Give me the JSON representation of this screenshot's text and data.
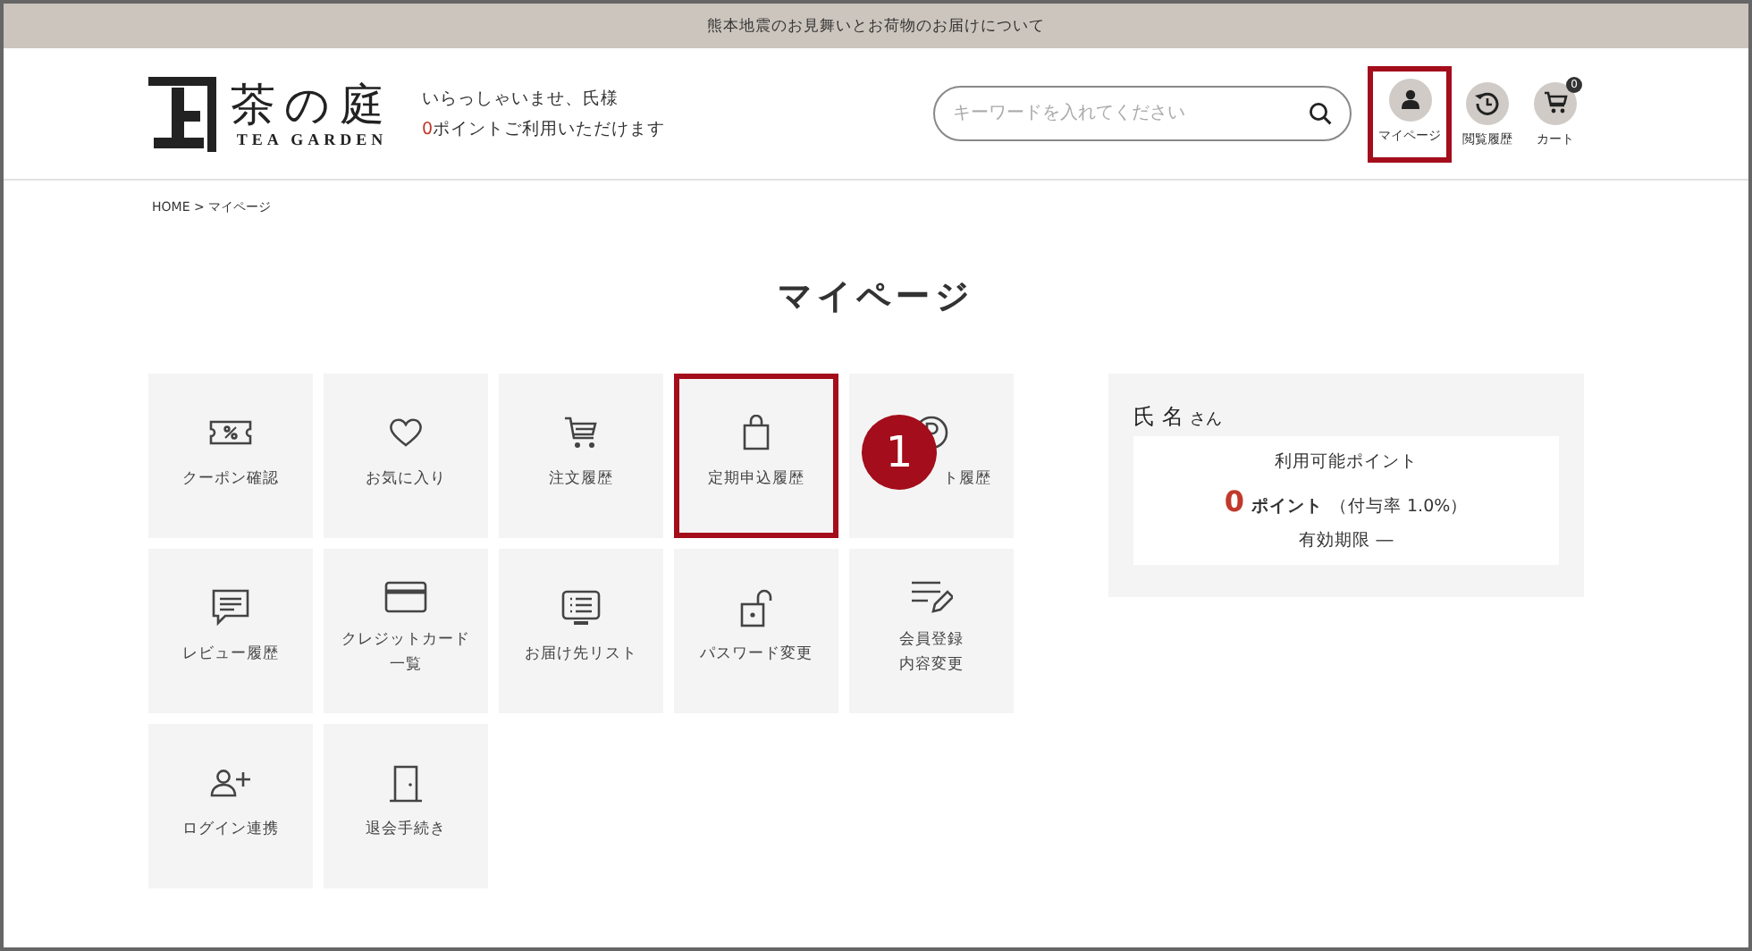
{
  "notice": "熊本地震のお見舞いとお荷物のお届けについて",
  "header": {
    "logo": {
      "name": "茶の庭",
      "sub": "TEA GARDEN"
    },
    "greeting": "いらっしゃいませ、氏様",
    "points_value": "0",
    "points_text": "ポイントご利用いただけます",
    "search": {
      "placeholder": "キーワードを入れてください"
    },
    "nav": [
      {
        "label": "マイページ",
        "highlighted": true
      },
      {
        "label": "閲覧履歴",
        "highlighted": false
      },
      {
        "label": "カート",
        "highlighted": false,
        "badge": "0"
      }
    ]
  },
  "breadcrumb": "HOME > マイページ",
  "title": "マイページ",
  "tiles": [
    {
      "label": "クーポン確認",
      "highlighted": false
    },
    {
      "label": "お気に入り",
      "highlighted": false
    },
    {
      "label": "注文履歴",
      "highlighted": false
    },
    {
      "label": "定期申込履歴",
      "highlighted": true
    },
    {
      "label": "ト履歴",
      "highlighted": false
    },
    {
      "label": "レビュー履歴",
      "highlighted": false
    },
    {
      "lines": [
        "クレジットカード",
        "一覧"
      ],
      "highlighted": false
    },
    {
      "label": "お届け先リスト",
      "highlighted": false
    },
    {
      "label": "パスワード変更",
      "highlighted": false
    },
    {
      "lines": [
        "会員登録",
        "内容変更"
      ],
      "highlighted": false
    },
    {
      "label": "ログイン連携",
      "highlighted": false
    },
    {
      "label": "退会手続き",
      "highlighted": false
    }
  ],
  "annotation": {
    "badge": "1"
  },
  "panel": {
    "name": "氏 名",
    "suffix": "さん",
    "points_title": "利用可能ポイント",
    "points": "0",
    "points_unit": "ポイント",
    "rate": "（付与率 1.0%）",
    "expiry": "有効期限 ―"
  }
}
